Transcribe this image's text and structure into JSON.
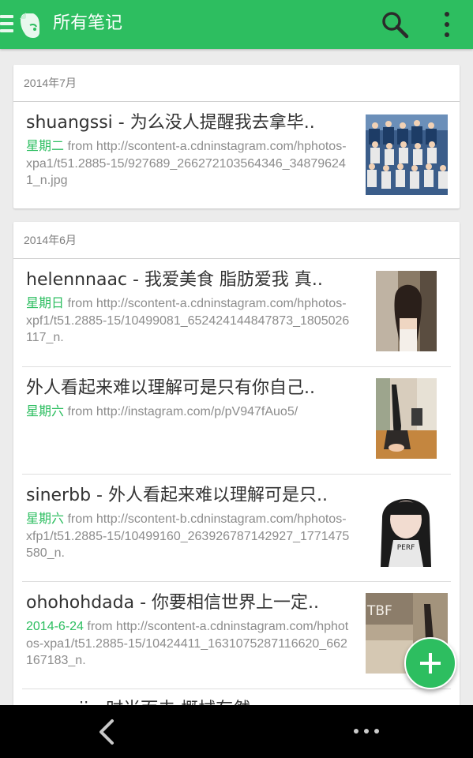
{
  "app_bar": {
    "title": "所有笔记",
    "menu_icon": "hamburger-icon",
    "logo_icon": "evernote-elephant-icon",
    "search_icon": "search-icon",
    "more_icon": "more-vert-icon",
    "color": "#2dbe60"
  },
  "sections": [
    {
      "header": "2014年7月",
      "notes": [
        {
          "title": "shuangssi - 为么没人提醒我去拿毕..",
          "date": "星期二",
          "meta": " from http://scontent-a.cdninstagram.com/hphotos-xpa1/t51.2885-15/927689_266272103564346_348796241_n.jpg"
        }
      ]
    },
    {
      "header": "2014年6月",
      "notes": [
        {
          "title": "helennnaac - 我爱美食 脂肪爱我 真..",
          "date": "星期日",
          "meta": " from http://scontent-a.cdninstagram.com/hphotos-xpf1/t51.2885-15/10499081_652424144847873_1805026117_n."
        },
        {
          "title": "外人看起来难以理解可是只有你自己..",
          "date": "星期六",
          "meta": " from http://instagram.com/p/pV947fAuo5/"
        },
        {
          "title": "sinerbb - 外人看起来难以理解可是只..",
          "date": "星期六",
          "meta": " from http://scontent-b.cdninstagram.com/hphotos-xfp1/t51.2885-15/10499160_263926787142927_1771475580_n."
        },
        {
          "title": "ohohohdada - 你要相信世界上一定..",
          "date": "2014-6-24",
          "meta": " from http://scontent-a.cdninstagram.com/hphotos-xpa1/t51.2885-15/10424411_1631075287116620_662167183_n."
        }
      ]
    }
  ],
  "partial_note_title": "～～～ii - 时尚而去 概械存然",
  "thumb_text": {
    "sinerbb": "PERF",
    "ohohohdada": "TBF"
  },
  "fab": {
    "icon": "plus-icon"
  },
  "nav_bar": {
    "back_icon": "back-chevron-icon",
    "overflow_icon": "overflow-dots-icon"
  }
}
